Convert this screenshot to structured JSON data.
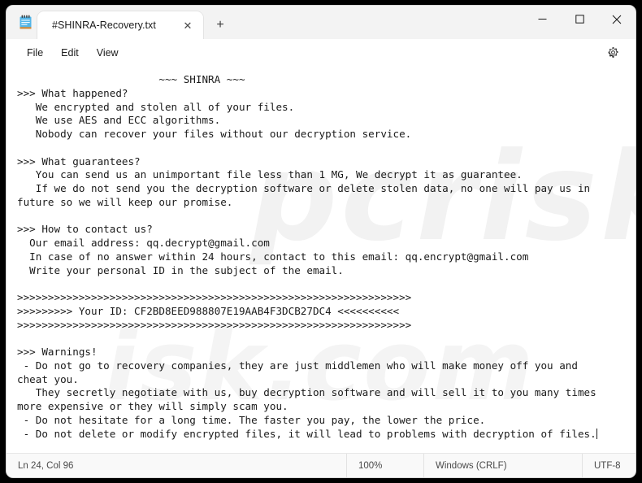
{
  "window": {
    "app_icon": "notepad-icon",
    "controls": {
      "minimize": "minimize-icon",
      "maximize": "maximize-icon",
      "close": "close-icon"
    }
  },
  "tabs": [
    {
      "title": "#SHINRA-Recovery.txt",
      "close_label": "✕",
      "active": true
    }
  ],
  "newtab": {
    "label": "+"
  },
  "menu": {
    "items": [
      {
        "label": "File"
      },
      {
        "label": "Edit"
      },
      {
        "label": "View"
      }
    ],
    "settings_icon": "gear-icon"
  },
  "document": {
    "lines": [
      "                       ~~~ SHINRA ~~~",
      ">>> What happened?",
      "   We encrypted and stolen all of your files.",
      "   We use AES and ECC algorithms.",
      "   Nobody can recover your files without our decryption service.",
      "",
      ">>> What guarantees?",
      "   You can send us an unimportant file less than 1 MG, We decrypt it as guarantee.",
      "   If we do not send you the decryption software or delete stolen data, no one will pay us in",
      "future so we will keep our promise.",
      "",
      ">>> How to contact us?",
      "  Our email address: qq.decrypt@gmail.com",
      "  In case of no answer within 24 hours, contact to this email: qq.encrypt@gmail.com",
      "  Write your personal ID in the subject of the email.",
      "",
      ">>>>>>>>>>>>>>>>>>>>>>>>>>>>>>>>>>>>>>>>>>>>>>>>>>>>>>>>>>>>>>>>",
      ">>>>>>>>> Your ID: CF2BD8EED988807E19AAB4F3DCB27DC4 <<<<<<<<<<",
      ">>>>>>>>>>>>>>>>>>>>>>>>>>>>>>>>>>>>>>>>>>>>>>>>>>>>>>>>>>>>>>>>",
      "",
      ">>> Warnings!",
      " - Do not go to recovery companies, they are just middlemen who will make money off you and",
      "cheat you.",
      "   They secretly negotiate with us, buy decryption software and will sell it to you many times",
      "more expensive or they will simply scam you.",
      " - Do not hesitate for a long time. The faster you pay, the lower the price.",
      " - Do not delete or modify encrypted files, it will lead to problems with decryption of files."
    ],
    "watermark_1": "pcrisk",
    "watermark_2": "isk.com"
  },
  "statusbar": {
    "position": "Ln 24, Col 96",
    "zoom": "100%",
    "line_ending": "Windows (CRLF)",
    "encoding": "UTF-8"
  },
  "colors": {
    "window_bg": "#f3f3f3",
    "editor_bg": "#ffffff",
    "text": "#1a1a1a",
    "desktop": "#000000"
  }
}
